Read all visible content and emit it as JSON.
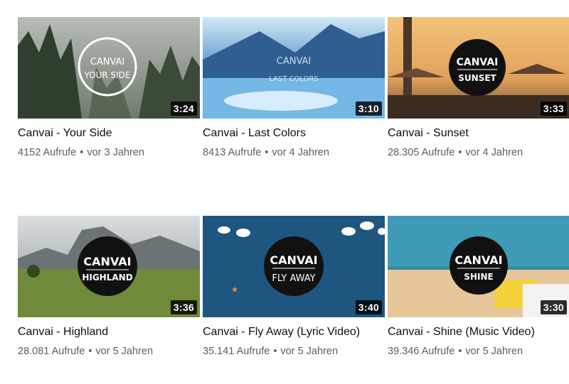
{
  "videos": [
    {
      "title": "Canvai - Your Side",
      "views": "4152 Aufrufe",
      "age": "vor 3 Jahren",
      "duration": "3:24",
      "logo_line1": "CANVAI",
      "logo_line2": "YOUR SIDE",
      "thumb_icon": "circle-logo-icon"
    },
    {
      "title": "Canvai - Last Colors",
      "views": "8413 Aufrufe",
      "age": "vor 4 Jahren",
      "duration": "3:10",
      "logo_line1": "CANVAI",
      "logo_line2": "LAST COLORS",
      "thumb_icon": "text-logo-icon"
    },
    {
      "title": "Canvai - Sunset",
      "views": "28.305 Aufrufe",
      "age": "vor 4 Jahren",
      "duration": "3:33",
      "logo_line1": "CANVAI",
      "logo_line2": "SUNSET",
      "thumb_icon": "black-circle-logo-icon"
    },
    {
      "title": "Canvai - Highland",
      "views": "28.081 Aufrufe",
      "age": "vor 5 Jahren",
      "duration": "3:36",
      "logo_line1": "CANVAI",
      "logo_line2": "HIGHLAND",
      "thumb_icon": "black-circle-logo-icon"
    },
    {
      "title": "Canvai - Fly Away (Lyric Video)",
      "views": "35.141 Aufrufe",
      "age": "vor 5 Jahren",
      "duration": "3:40",
      "logo_line1": "CANVAI",
      "logo_line2": "FLY AWAY",
      "thumb_icon": "black-circle-logo-icon"
    },
    {
      "title": "Canvai - Shine (Music Video)",
      "views": "39.346 Aufrufe",
      "age": "vor 5 Jahren",
      "duration": "3:30",
      "logo_line1": "CANVAI",
      "logo_line2": "SHINE",
      "thumb_icon": "black-circle-logo-icon"
    }
  ],
  "separator": "•",
  "colors": {
    "title": "#0f0f0f",
    "meta": "#606060",
    "duration_bg": "#000000"
  }
}
